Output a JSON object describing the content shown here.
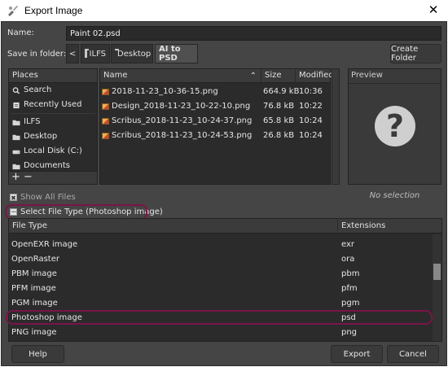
{
  "window": {
    "title": "Export Image",
    "close_glyph": "✕"
  },
  "name_row": {
    "label": "Name:",
    "value": "Paint 02.psd"
  },
  "folder_row": {
    "label": "Save in folder:",
    "back_glyph": "<",
    "crumbs": [
      "ILFS",
      "Desktop",
      "AI to PSD"
    ],
    "create_folder_label": "Create Folder"
  },
  "places": {
    "header": "Places",
    "items": [
      {
        "label": "Search",
        "icon": "search-icon"
      },
      {
        "label": "Recently Used",
        "icon": "recent-icon"
      },
      {
        "label": "ILFS",
        "icon": "folder-icon"
      },
      {
        "label": "Desktop",
        "icon": "folder-icon"
      },
      {
        "label": "Local Disk (C:)",
        "icon": "disk-icon"
      },
      {
        "label": "Documents",
        "icon": "folder-icon"
      }
    ],
    "add_glyph": "+",
    "remove_glyph": "−"
  },
  "files": {
    "columns": {
      "name": "Name",
      "size": "Size",
      "modified": "Modified",
      "sort_glyph": "⌃"
    },
    "rows": [
      {
        "name": "2018-11-23_10-36-15.png",
        "size": "664.9 kB",
        "modified": "10:36"
      },
      {
        "name": "Design_2018-11-23_10-22-10.png",
        "size": "76.8 kB",
        "modified": "10:22"
      },
      {
        "name": "Scribus_2018-11-23_10-24-37.png",
        "size": "65.8 kB",
        "modified": "10:24"
      },
      {
        "name": "Scribus_2018-11-23_10-24-53.png",
        "size": "26.8 kB",
        "modified": "10:24"
      }
    ]
  },
  "preview": {
    "title": "Preview",
    "glyph": "?",
    "note": "No selection"
  },
  "show_all_files": {
    "label": "Show All Files",
    "glyph": "✖"
  },
  "select_file_type": {
    "label": "Select File Type (Photoshop image)",
    "glyph": "−"
  },
  "file_types": {
    "columns": {
      "type": "File Type",
      "ext": "Extensions"
    },
    "rows": [
      {
        "name": "OpenEXR image",
        "ext": "exr"
      },
      {
        "name": "OpenRaster",
        "ext": "ora"
      },
      {
        "name": "PBM image",
        "ext": "pbm"
      },
      {
        "name": "PFM image",
        "ext": "pfm"
      },
      {
        "name": "PGM image",
        "ext": "pgm"
      },
      {
        "name": "Photoshop image",
        "ext": "psd"
      },
      {
        "name": "PNG image",
        "ext": "png"
      }
    ]
  },
  "buttons": {
    "help": "Help",
    "export": "Export",
    "cancel": "Cancel"
  },
  "colors": {
    "highlight": "#7a1447",
    "dialog_bg": "#454545"
  }
}
